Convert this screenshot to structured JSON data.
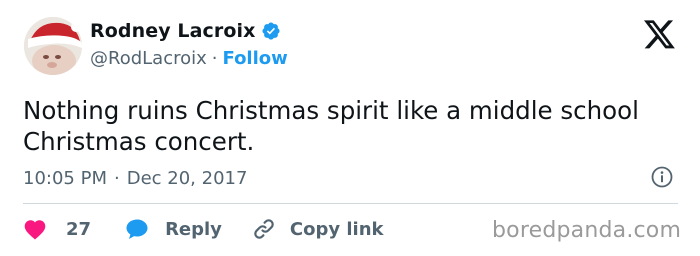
{
  "author": {
    "name": "Rodney Lacroix",
    "handle": "@RodLacroix",
    "separator": "·",
    "follow_label": "Follow"
  },
  "tweet": {
    "text": "Nothing ruins Christmas spirit like a middle school\nChristmas concert.",
    "time": "10:05 PM",
    "date_separator": "·",
    "date": "Dec 20, 2017"
  },
  "actions": {
    "like_count": "27",
    "reply_label": "Reply",
    "copy_link_label": "Copy link"
  },
  "watermark": "boredpanda.com",
  "colors": {
    "accent": "#1d9bf0",
    "like": "#f91880",
    "text": "#0f1419",
    "secondary": "#536471"
  },
  "icons": {
    "verified": "verified-badge-icon",
    "logo": "x-logo-icon",
    "info": "info-icon",
    "like": "heart-icon",
    "reply": "speech-bubble-icon",
    "copy_link": "link-icon"
  }
}
